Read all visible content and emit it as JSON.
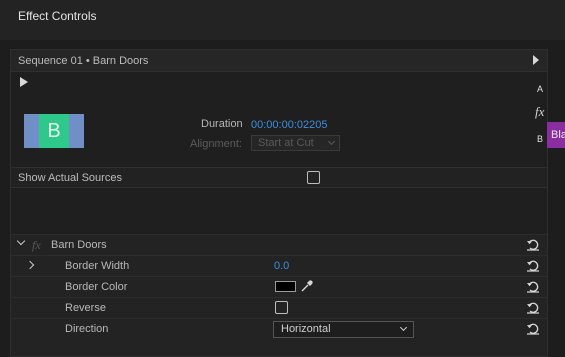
{
  "panel": {
    "title": "Effect Controls"
  },
  "sequence": {
    "label": "Sequence 01 • Barn Doors"
  },
  "preview": {
    "thumbnail_letter": "B",
    "duration_label": "Duration",
    "duration_value": "00:00:00:02205",
    "alignment_label": "Alignment:",
    "alignment_value": "Start at Cut"
  },
  "show_sources": {
    "label": "Show Actual Sources",
    "checked": false
  },
  "effect": {
    "name": "Barn Doors",
    "params": {
      "border_width": {
        "label": "Border Width",
        "value": "0.0"
      },
      "border_color": {
        "label": "Border Color",
        "value": "#000000"
      },
      "reverse": {
        "label": "Reverse",
        "checked": false
      },
      "direction": {
        "label": "Direction",
        "value": "Horizontal"
      }
    }
  },
  "timeline_strip": {
    "track_a": "A",
    "fx": "fx",
    "track_b": "B",
    "clip_label": "Bla"
  },
  "colors": {
    "accent_blue": "#3d8fe0",
    "thumb_green": "#2ec98a",
    "thumb_blue": "#6f8fc6",
    "clip_purple": "#8a2da1"
  }
}
